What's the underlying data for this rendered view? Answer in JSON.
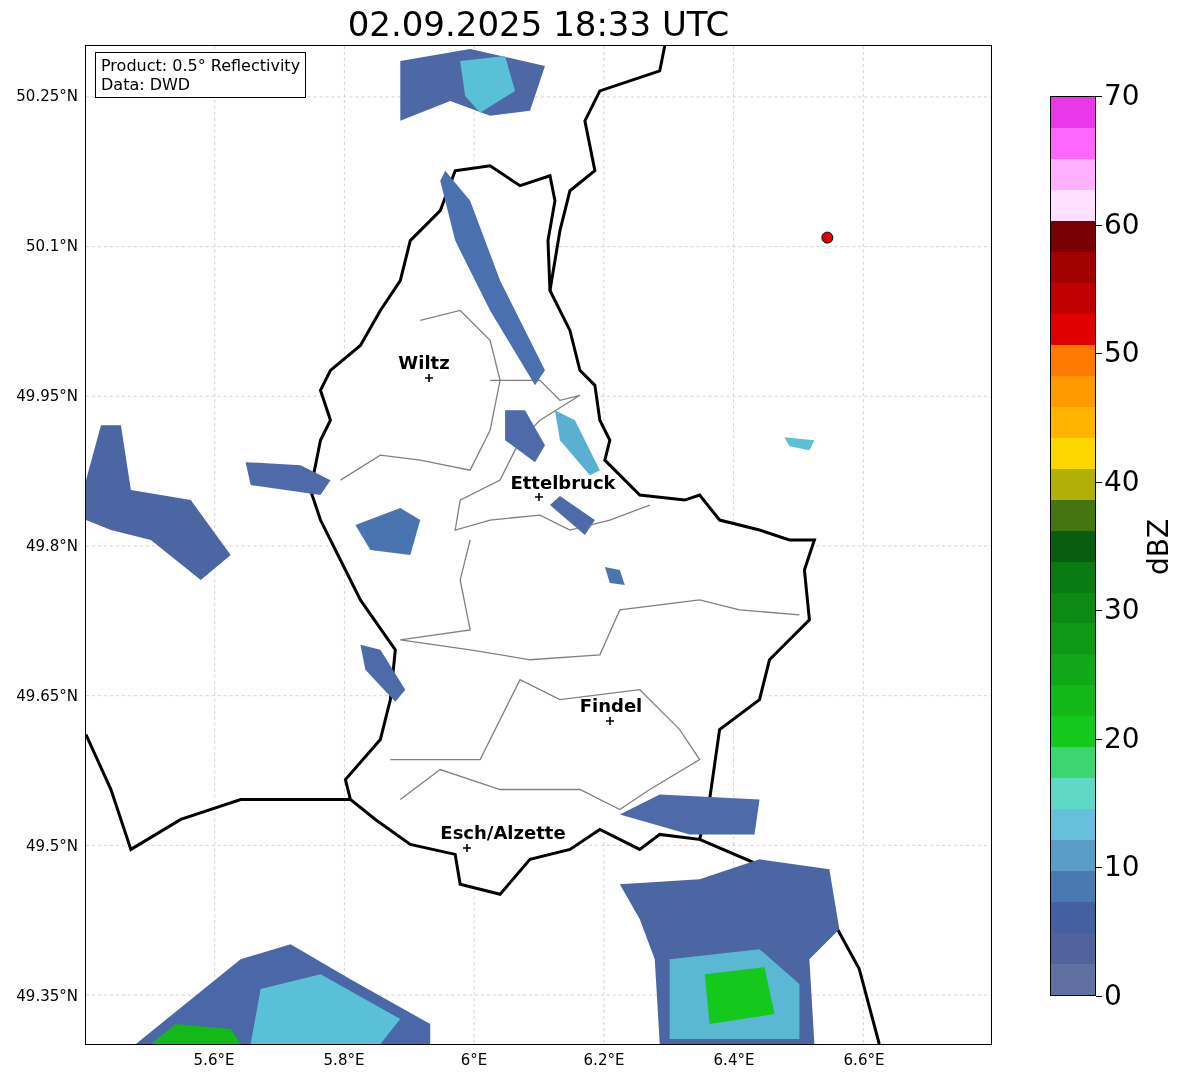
{
  "title": "02.09.2025 18:33 UTC",
  "info_box": [
    "Product: 0.5° Reflectivity",
    "Data: DWD"
  ],
  "cities": [
    {
      "name": "Wiltz"
    },
    {
      "name": "Ettelbruck"
    },
    {
      "name": "Findel"
    },
    {
      "name": "Esch/Alzette"
    }
  ],
  "y_ticks": [
    "50.25°N",
    "50.1°N",
    "49.95°N",
    "49.8°N",
    "49.65°N",
    "49.5°N",
    "49.35°N"
  ],
  "x_ticks": [
    "5.6°E",
    "5.8°E",
    "6°E",
    "6.2°E",
    "6.4°E",
    "6.6°E"
  ],
  "colorbar": {
    "label": "dBZ",
    "ticks": [
      "70",
      "60",
      "50",
      "40",
      "30",
      "20",
      "10",
      "0"
    ],
    "bands": [
      {
        "color": "#e838e8"
      },
      {
        "color": "#ff66ff"
      },
      {
        "color": "#ffb0ff"
      },
      {
        "color": "#ffe0ff"
      },
      {
        "color": "#780000"
      },
      {
        "color": "#a00000"
      },
      {
        "color": "#c00000"
      },
      {
        "color": "#e00000"
      },
      {
        "color": "#ff7a00"
      },
      {
        "color": "#ff9a00"
      },
      {
        "color": "#ffb500"
      },
      {
        "color": "#ffd700"
      },
      {
        "color": "#b0b008"
      },
      {
        "color": "#457510"
      },
      {
        "color": "#0a5c10"
      },
      {
        "color": "#0a7a12"
      },
      {
        "color": "#0d8a14"
      },
      {
        "color": "#0e9818"
      },
      {
        "color": "#10a818"
      },
      {
        "color": "#12b818"
      },
      {
        "color": "#14c81c"
      },
      {
        "color": "#3cd670"
      },
      {
        "color": "#60d8c8"
      },
      {
        "color": "#66c0dc"
      },
      {
        "color": "#5a9ec8"
      },
      {
        "color": "#4a78b0"
      },
      {
        "color": "#4460a0"
      },
      {
        "color": "#52629c"
      },
      {
        "color": "#6070a0"
      }
    ]
  }
}
